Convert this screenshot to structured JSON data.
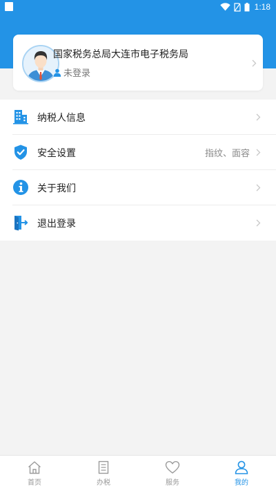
{
  "status_bar": {
    "time": "1:18",
    "icons": [
      "notification-icon",
      "wifi-icon",
      "no-sim-icon",
      "battery-icon"
    ]
  },
  "colors": {
    "accent": "#2393e6",
    "background": "#f3f3f3",
    "card": "#ffffff",
    "chevron": "#c8c8c8"
  },
  "profile": {
    "org_name": "国家税务总局大连市电子税务局",
    "login_status": "未登录",
    "avatar_icon": "user-avatar",
    "status_icon": "person-icon"
  },
  "menu": {
    "items": [
      {
        "label": "纳税人信息",
        "value": "",
        "icon": "building-icon"
      },
      {
        "label": "安全设置",
        "value": "指纹、面容",
        "icon": "shield-check-icon"
      },
      {
        "label": "关于我们",
        "value": "",
        "icon": "info-icon"
      },
      {
        "label": "退出登录",
        "value": "",
        "icon": "logout-icon"
      }
    ]
  },
  "tabbar": {
    "items": [
      {
        "label": "首页",
        "icon": "home-icon",
        "active": false
      },
      {
        "label": "办税",
        "icon": "document-icon",
        "active": false
      },
      {
        "label": "服务",
        "icon": "heart-icon",
        "active": false
      },
      {
        "label": "我的",
        "icon": "user-icon",
        "active": true
      }
    ]
  }
}
